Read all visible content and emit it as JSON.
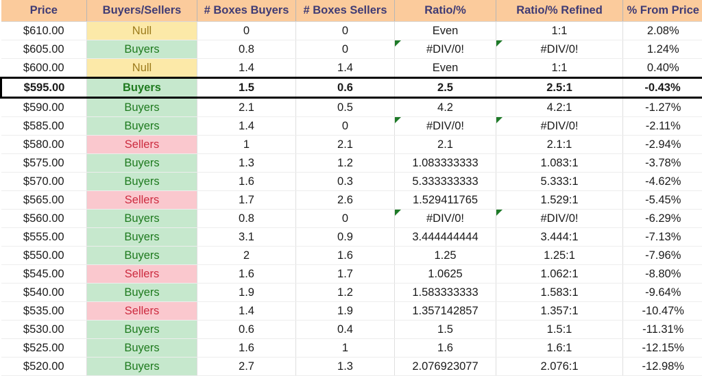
{
  "table": {
    "name": "price-levels-buyers-sellers-table",
    "columns": [
      {
        "key": "price",
        "label": "Price"
      },
      {
        "key": "buyers_sellers",
        "label": "Buyers/Sellers"
      },
      {
        "key": "boxes_buyers",
        "label": "# Boxes Buyers"
      },
      {
        "key": "boxes_sellers",
        "label": "# Boxes Sellers"
      },
      {
        "key": "ratio",
        "label": "Ratio/%"
      },
      {
        "key": "ratio_refined",
        "label": "Ratio/% Refined"
      },
      {
        "key": "pct_from_price",
        "label": "% From Price"
      }
    ],
    "colors": {
      "header_fill": "#fbcb9c",
      "header_text": "#3f3b74",
      "buyers_fill": "#c6e8cd",
      "buyers_text": "#1e7a1e",
      "sellers_fill": "#fac8ce",
      "sellers_text": "#cc2b3f",
      "null_fill": "#fce9a8",
      "null_text": "#9c7b1c",
      "error_flag": "#1e7a28",
      "highlight_border": "#000000"
    },
    "rows": [
      {
        "price": "$610.00",
        "buyers_sellers": "Null",
        "status": "null",
        "boxes_buyers": "0",
        "boxes_sellers": "0",
        "ratio": "Even",
        "ratio_flag": false,
        "ratio_refined": "1:1",
        "refined_flag": false,
        "pct_from_price": "2.08%",
        "highlight": false
      },
      {
        "price": "$605.00",
        "buyers_sellers": "Buyers",
        "status": "buyers",
        "boxes_buyers": "0.8",
        "boxes_sellers": "0",
        "ratio": "#DIV/0!",
        "ratio_flag": true,
        "ratio_refined": "#DIV/0!",
        "refined_flag": true,
        "pct_from_price": "1.24%",
        "highlight": false
      },
      {
        "price": "$600.00",
        "buyers_sellers": "Null",
        "status": "null",
        "boxes_buyers": "1.4",
        "boxes_sellers": "1.4",
        "ratio": "Even",
        "ratio_flag": false,
        "ratio_refined": "1:1",
        "refined_flag": false,
        "pct_from_price": "0.40%",
        "highlight": false
      },
      {
        "price": "$595.00",
        "buyers_sellers": "Buyers",
        "status": "buyers",
        "boxes_buyers": "1.5",
        "boxes_sellers": "0.6",
        "ratio": "2.5",
        "ratio_flag": false,
        "ratio_refined": "2.5:1",
        "refined_flag": false,
        "pct_from_price": "-0.43%",
        "highlight": true
      },
      {
        "price": "$590.00",
        "buyers_sellers": "Buyers",
        "status": "buyers",
        "boxes_buyers": "2.1",
        "boxes_sellers": "0.5",
        "ratio": "4.2",
        "ratio_flag": false,
        "ratio_refined": "4.2:1",
        "refined_flag": false,
        "pct_from_price": "-1.27%",
        "highlight": false
      },
      {
        "price": "$585.00",
        "buyers_sellers": "Buyers",
        "status": "buyers",
        "boxes_buyers": "1.4",
        "boxes_sellers": "0",
        "ratio": "#DIV/0!",
        "ratio_flag": true,
        "ratio_refined": "#DIV/0!",
        "refined_flag": true,
        "pct_from_price": "-2.11%",
        "highlight": false
      },
      {
        "price": "$580.00",
        "buyers_sellers": "Sellers",
        "status": "sellers",
        "boxes_buyers": "1",
        "boxes_sellers": "2.1",
        "ratio": "2.1",
        "ratio_flag": false,
        "ratio_refined": "2.1:1",
        "refined_flag": false,
        "pct_from_price": "-2.94%",
        "highlight": false
      },
      {
        "price": "$575.00",
        "buyers_sellers": "Buyers",
        "status": "buyers",
        "boxes_buyers": "1.3",
        "boxes_sellers": "1.2",
        "ratio": "1.083333333",
        "ratio_flag": false,
        "ratio_refined": "1.083:1",
        "refined_flag": false,
        "pct_from_price": "-3.78%",
        "highlight": false
      },
      {
        "price": "$570.00",
        "buyers_sellers": "Buyers",
        "status": "buyers",
        "boxes_buyers": "1.6",
        "boxes_sellers": "0.3",
        "ratio": "5.333333333",
        "ratio_flag": false,
        "ratio_refined": "5.333:1",
        "refined_flag": false,
        "pct_from_price": "-4.62%",
        "highlight": false
      },
      {
        "price": "$565.00",
        "buyers_sellers": "Sellers",
        "status": "sellers",
        "boxes_buyers": "1.7",
        "boxes_sellers": "2.6",
        "ratio": "1.529411765",
        "ratio_flag": false,
        "ratio_refined": "1.529:1",
        "refined_flag": false,
        "pct_from_price": "-5.45%",
        "highlight": false
      },
      {
        "price": "$560.00",
        "buyers_sellers": "Buyers",
        "status": "buyers",
        "boxes_buyers": "0.8",
        "boxes_sellers": "0",
        "ratio": "#DIV/0!",
        "ratio_flag": true,
        "ratio_refined": "#DIV/0!",
        "refined_flag": true,
        "pct_from_price": "-6.29%",
        "highlight": false
      },
      {
        "price": "$555.00",
        "buyers_sellers": "Buyers",
        "status": "buyers",
        "boxes_buyers": "3.1",
        "boxes_sellers": "0.9",
        "ratio": "3.444444444",
        "ratio_flag": false,
        "ratio_refined": "3.444:1",
        "refined_flag": false,
        "pct_from_price": "-7.13%",
        "highlight": false
      },
      {
        "price": "$550.00",
        "buyers_sellers": "Buyers",
        "status": "buyers",
        "boxes_buyers": "2",
        "boxes_sellers": "1.6",
        "ratio": "1.25",
        "ratio_flag": false,
        "ratio_refined": "1.25:1",
        "refined_flag": false,
        "pct_from_price": "-7.96%",
        "highlight": false
      },
      {
        "price": "$545.00",
        "buyers_sellers": "Sellers",
        "status": "sellers",
        "boxes_buyers": "1.6",
        "boxes_sellers": "1.7",
        "ratio": "1.0625",
        "ratio_flag": false,
        "ratio_refined": "1.062:1",
        "refined_flag": false,
        "pct_from_price": "-8.80%",
        "highlight": false
      },
      {
        "price": "$540.00",
        "buyers_sellers": "Buyers",
        "status": "buyers",
        "boxes_buyers": "1.9",
        "boxes_sellers": "1.2",
        "ratio": "1.583333333",
        "ratio_flag": false,
        "ratio_refined": "1.583:1",
        "refined_flag": false,
        "pct_from_price": "-9.64%",
        "highlight": false
      },
      {
        "price": "$535.00",
        "buyers_sellers": "Sellers",
        "status": "sellers",
        "boxes_buyers": "1.4",
        "boxes_sellers": "1.9",
        "ratio": "1.357142857",
        "ratio_flag": false,
        "ratio_refined": "1.357:1",
        "refined_flag": false,
        "pct_from_price": "-10.47%",
        "highlight": false
      },
      {
        "price": "$530.00",
        "buyers_sellers": "Buyers",
        "status": "buyers",
        "boxes_buyers": "0.6",
        "boxes_sellers": "0.4",
        "ratio": "1.5",
        "ratio_flag": false,
        "ratio_refined": "1.5:1",
        "refined_flag": false,
        "pct_from_price": "-11.31%",
        "highlight": false
      },
      {
        "price": "$525.00",
        "buyers_sellers": "Buyers",
        "status": "buyers",
        "boxes_buyers": "1.6",
        "boxes_sellers": "1",
        "ratio": "1.6",
        "ratio_flag": false,
        "ratio_refined": "1.6:1",
        "refined_flag": false,
        "pct_from_price": "-12.15%",
        "highlight": false
      },
      {
        "price": "$520.00",
        "buyers_sellers": "Buyers",
        "status": "buyers",
        "boxes_buyers": "2.7",
        "boxes_sellers": "1.3",
        "ratio": "2.076923077",
        "ratio_flag": false,
        "ratio_refined": "2.076:1",
        "refined_flag": false,
        "pct_from_price": "-12.98%",
        "highlight": false
      }
    ]
  }
}
